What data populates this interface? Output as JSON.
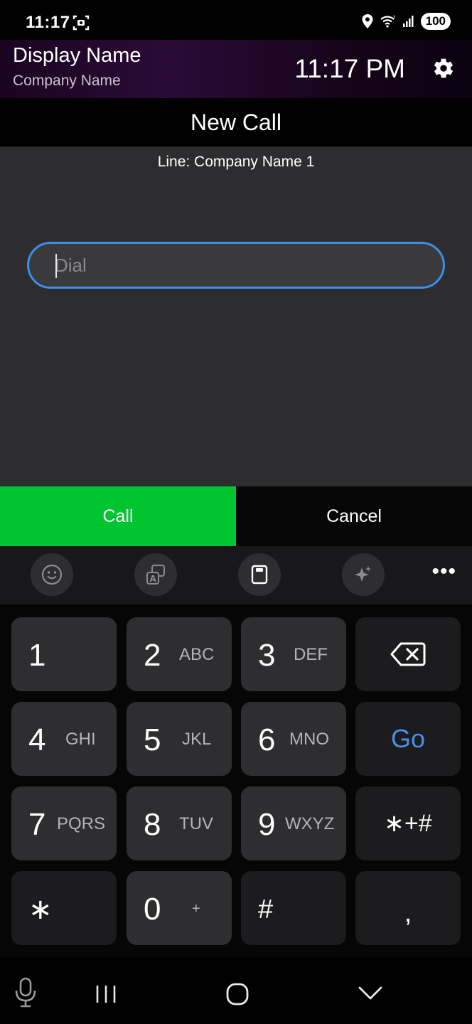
{
  "status_bar": {
    "time": "11:17",
    "battery": "100",
    "icons": [
      "screenshot-scan-icon",
      "location-icon",
      "wifi-icon",
      "signal-icon",
      "battery-icon"
    ]
  },
  "header": {
    "display_name": "Display Name",
    "company_name": "Company Name",
    "clock": "11:17 PM",
    "settings_icon": "gear-icon"
  },
  "title": "New Call",
  "line_label": "Line: Company Name 1",
  "dial": {
    "placeholder": "Dial",
    "value": ""
  },
  "actions": {
    "call_label": "Call",
    "cancel_label": "Cancel"
  },
  "keyboard_toolbar": {
    "icons": [
      "emoji-icon",
      "translate-icon",
      "clipboard-icon",
      "ai-sparkle-icon"
    ],
    "more_label": "•••"
  },
  "keypad": {
    "keys": [
      {
        "num": "1",
        "letters": ""
      },
      {
        "num": "2",
        "letters": "ABC"
      },
      {
        "num": "3",
        "letters": "DEF"
      },
      {
        "num": "4",
        "letters": "GHI"
      },
      {
        "num": "5",
        "letters": "JKL"
      },
      {
        "num": "6",
        "letters": "MNO"
      },
      {
        "num": "7",
        "letters": "PQRS"
      },
      {
        "num": "8",
        "letters": "TUV"
      },
      {
        "num": "9",
        "letters": "WXYZ"
      },
      {
        "num": "∗",
        "letters": ""
      },
      {
        "num": "0",
        "letters": "+"
      },
      {
        "num": "#",
        "letters": ""
      }
    ],
    "go_label": "Go",
    "symbols_label": "∗+#",
    "comma_label": ","
  },
  "nav_bar": {
    "icons": [
      "microphone-icon",
      "recent-apps-icon",
      "home-icon",
      "hide-keyboard-icon"
    ]
  },
  "colors": {
    "accent_blue": "#3d8ee8",
    "call_green": "#00c531",
    "header_purple": "#2a0a36"
  }
}
